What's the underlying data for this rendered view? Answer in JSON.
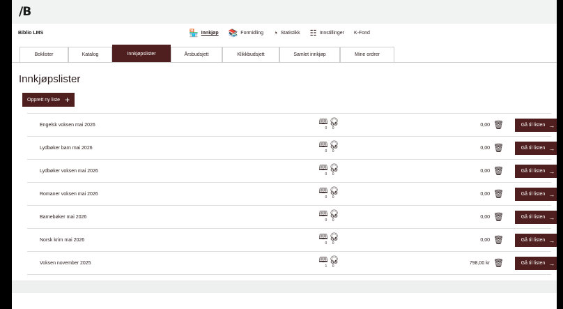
{
  "logo": {
    "text": "/B"
  },
  "app": {
    "name": "Biblio LMS"
  },
  "topnav": [
    {
      "label": "Innkjøp",
      "icon": "store-icon"
    },
    {
      "label": "Formidling",
      "icon": "books-icon"
    },
    {
      "label": "Statistikk",
      "icon": "pie-chart-icon"
    },
    {
      "label": "Innstillinger",
      "icon": "org-chart-icon"
    },
    {
      "label": "K-Fond",
      "icon": ""
    }
  ],
  "tabs": [
    {
      "label": "Boklister"
    },
    {
      "label": "Katalog"
    },
    {
      "label": "Innkjøpslister"
    },
    {
      "label": "Årsbudsjett"
    },
    {
      "label": "Klikkbudsjett"
    },
    {
      "label": "Samlet innkjøp"
    },
    {
      "label": "Mine ordrer"
    }
  ],
  "page": {
    "title": "Innkjøpslister",
    "create_label": "Opprett ny liste"
  },
  "lists": [
    {
      "name": "Engelsk voksen mai 2026",
      "books": "0",
      "audio": "0",
      "amount": "0,00",
      "go_label": "Gå til listen"
    },
    {
      "name": "Lydbøker barn mai 2026",
      "books": "0",
      "audio": "0",
      "amount": "0,00",
      "go_label": "Gå til listen"
    },
    {
      "name": "Lydbøker voksen mai 2026",
      "books": "0",
      "audio": "0",
      "amount": "0,00",
      "go_label": "Gå til listen"
    },
    {
      "name": "Romaner voksen mai 2026",
      "books": "0",
      "audio": "0",
      "amount": "0,00",
      "go_label": "Gå til listen"
    },
    {
      "name": "Barnebøker mai 2026",
      "books": "0",
      "audio": "0",
      "amount": "0,00",
      "go_label": "Gå til listen"
    },
    {
      "name": "Norsk krim mai 2026",
      "books": "0",
      "audio": "0",
      "amount": "0,00",
      "go_label": "Gå til listen"
    },
    {
      "name": "Voksen november 2025",
      "books": "1",
      "audio": "0",
      "amount": "798,00 kr",
      "go_label": "Gå til listen"
    }
  ],
  "colors": {
    "accent": "#4f1e1e",
    "topbar": "#f1f2f2",
    "footer": "#eef0f0"
  }
}
